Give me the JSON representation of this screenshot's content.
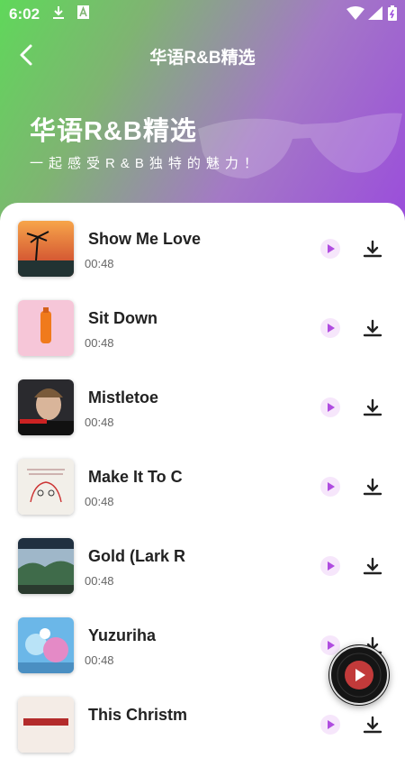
{
  "status_bar": {
    "time": "6:02"
  },
  "nav": {
    "title": "华语R&B精选"
  },
  "hero": {
    "title": "华语R&B精选",
    "subtitle": "一起感受R&B独特的魅力！"
  },
  "songs": [
    {
      "title": "Show Me Love",
      "duration": "00:48"
    },
    {
      "title": "Sit Down",
      "duration": "00:48"
    },
    {
      "title": "Mistletoe",
      "duration": "00:48"
    },
    {
      "title": "Make It To C",
      "duration": "00:48"
    },
    {
      "title": "Gold (Lark R",
      "duration": "00:48"
    },
    {
      "title": "Yuzuriha",
      "duration": "00:48"
    },
    {
      "title": "This Christm",
      "duration": ""
    }
  ],
  "colors": {
    "accent": "#b04ce0",
    "gradient_start": "#5fd85a",
    "gradient_end": "#9a4bdc"
  }
}
